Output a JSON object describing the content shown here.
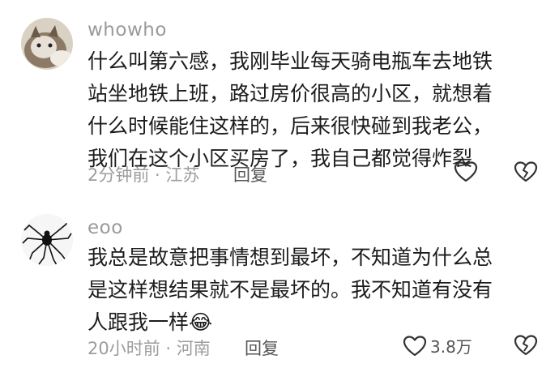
{
  "comments": [
    {
      "username": "whowho",
      "lines": [
        "什么叫第六感，我刚毕业每天骑电瓶车去地铁",
        "站坐地铁上班，路过房价很高的小区，就想着",
        "什么时候能住这样的，后来很快碰到我老公，",
        "我们在这个小区买房了，我自己都觉得炸裂"
      ],
      "time": "2分钟前 · 江苏",
      "reply_label": "回复",
      "like_count": ""
    },
    {
      "username": "eoo",
      "lines": [
        "我总是故意把事情想到最坏，不知道为什么总",
        "是这样想结果就不是最坏的。我不知道有没有",
        "人跟我一样"
      ],
      "emoji": "😂",
      "time": "20小时前 · 河南",
      "reply_label": "回复",
      "like_count": "3.8万"
    }
  ],
  "colors": {
    "text": "#1c1c1c",
    "muted": "#9a9a9a",
    "icon": "#333333"
  },
  "icons": [
    "heart-outline-icon",
    "broken-heart-icon"
  ]
}
